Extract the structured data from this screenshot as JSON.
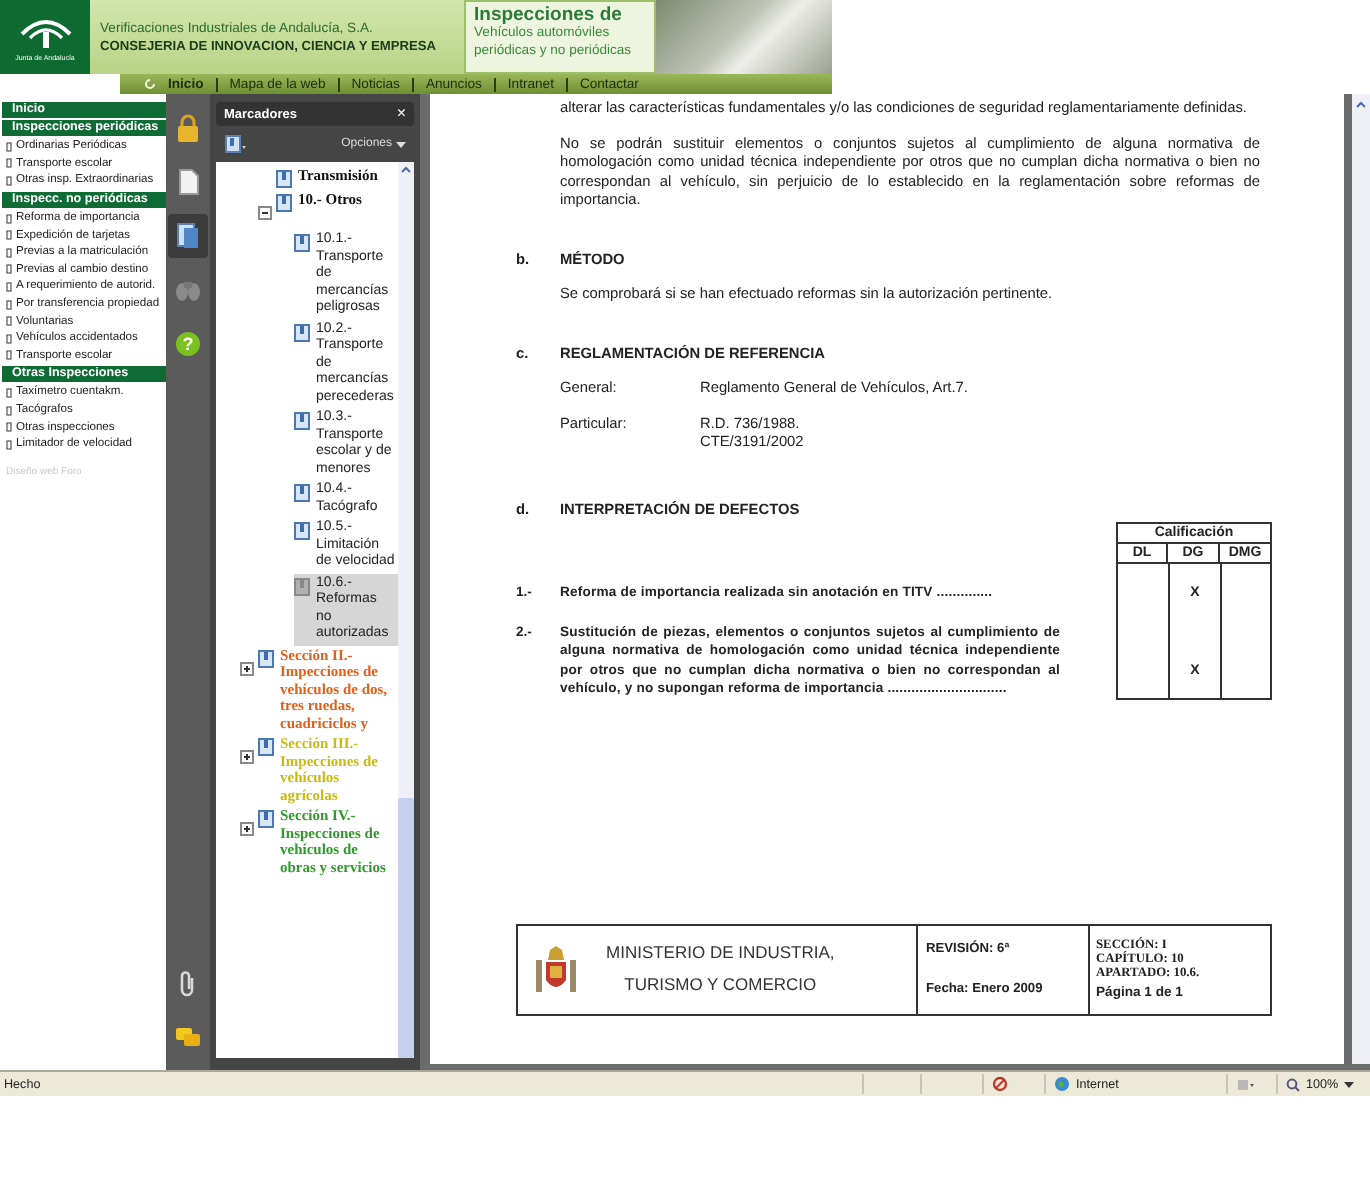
{
  "header": {
    "logo_caption": "Junta de Andalucía",
    "organization": "Verificaciones Industriales de Andalucía, S.A.",
    "department": "CONSEJERIA DE INNOVACION, CIENCIA Y EMPRESA",
    "service_title": "Inspecciones de",
    "service_lines": [
      "Vehículos automóviles",
      "periódicas y no periódicas"
    ]
  },
  "nav": [
    {
      "label": "Inicio",
      "selected": true
    },
    {
      "label": "Mapa de la web",
      "selected": false
    },
    {
      "label": "Noticias",
      "selected": false
    },
    {
      "label": "Anuncios",
      "selected": false
    },
    {
      "label": "Intranet",
      "selected": false
    },
    {
      "label": "Contactar",
      "selected": false
    }
  ],
  "side_menu": {
    "items": [
      {
        "kind": "header",
        "label": "Inicio"
      },
      {
        "kind": "header",
        "label": "Inspecciones periódicas"
      },
      {
        "kind": "item",
        "label": "Ordinarias Periódicas"
      },
      {
        "kind": "item",
        "label": "Transporte escolar"
      },
      {
        "kind": "item",
        "label": "Otras insp. Extraordinarias"
      },
      {
        "kind": "header",
        "label": "Inspecc. no periódicas"
      },
      {
        "kind": "item",
        "label": "Reforma de importancia"
      },
      {
        "kind": "item",
        "label": "Expedición de tarjetas"
      },
      {
        "kind": "item",
        "label": "Previas a la matriculación"
      },
      {
        "kind": "item",
        "label": "Previas al cambio destino"
      },
      {
        "kind": "item",
        "label": "A requerimiento de autorid."
      },
      {
        "kind": "item",
        "label": "Por transferencia propiedad"
      },
      {
        "kind": "item",
        "label": "Voluntarias"
      },
      {
        "kind": "item",
        "label": "Vehículos accidentados"
      },
      {
        "kind": "item",
        "label": "Transporte escolar"
      },
      {
        "kind": "header",
        "label": "Otras Inspecciones"
      },
      {
        "kind": "item",
        "label": "Taxímetro cuentakm."
      },
      {
        "kind": "item",
        "label": "Tacógrafos"
      },
      {
        "kind": "item",
        "label": "Otras inspecciones"
      },
      {
        "kind": "item",
        "label": "Limitador de velocidad"
      }
    ],
    "footer": "Diseño web Foro"
  },
  "viewer": {
    "tools": [
      {
        "kind": "lock",
        "selected": false
      },
      {
        "kind": "pages",
        "selected": false
      },
      {
        "kind": "bookmarks",
        "selected": true
      },
      {
        "kind": "binoculars",
        "selected": false
      },
      {
        "kind": "help",
        "symbol": "?",
        "selected": false
      }
    ],
    "bottom_tools": [
      {
        "kind": "paperclip"
      },
      {
        "kind": "comments"
      }
    ]
  },
  "bookmarks": {
    "title": "Marcadores",
    "close": "×",
    "options": "Opciones",
    "tree": [
      {
        "kind": "hidden",
        "children": [
          {
            "kind": "chapter",
            "label": "Transmisión",
            "selected": false
          },
          {
            "kind": "chapter",
            "label": "10.- Otros",
            "expanded": true,
            "selected": false,
            "children": [
              {
                "kind": "article",
                "label": "10.1.- Transporte de mercancías peligrosas",
                "selected": false
              },
              {
                "kind": "article",
                "label": "10.2.- Transporte de mercancías perecederas",
                "selected": false
              },
              {
                "kind": "article",
                "label": "10.3.- Transporte escolar y de menores",
                "selected": false
              },
              {
                "kind": "article",
                "label": "10.4.- Tacógrafo",
                "selected": false
              },
              {
                "kind": "article",
                "label": "10.5.- Limitación de velocidad",
                "selected": false
              },
              {
                "kind": "article",
                "label": "10.6.- Reformas no autorizadas",
                "selected": true
              }
            ]
          }
        ]
      },
      {
        "kind": "section",
        "label": "Sección II.- Impecciones de vehículos de dos, tres ruedas, cuadriciclos y",
        "expanded": false,
        "selected": false,
        "color": "#e0601c"
      },
      {
        "kind": "section",
        "label": "Sección III.- Impecciones de vehículos agrícolas",
        "expanded": false,
        "selected": false,
        "color": "#c9bb10"
      },
      {
        "kind": "section",
        "label": "Sección IV.- Inspecciones de vehículos de obras y servicios",
        "expanded": false,
        "selected": false,
        "color": "#2f9a2a"
      }
    ]
  },
  "document": {
    "paragraphs": [
      "alterar las características fundamentales y/o las condiciones de seguridad reglamentariamente definidas.",
      "No se podrán sustituir elementos o conjuntos sujetos al cumplimiento de alguna normativa de homologación como unidad técnica independiente por otros que no cumplan dicha normativa o bien no correspondan al vehículo, sin perjuicio de lo establecido en la reglamentación sobre reformas de importancia."
    ],
    "sections": [
      {
        "kind": "text",
        "letter": "b.",
        "title": "MÉTODO",
        "text": "Se comprobará si se han efectuado reformas sin la autorización pertinente."
      },
      {
        "kind": "references",
        "letter": "c.",
        "title": "REGLAMENTACIÓN DE REFERENCIA",
        "references": [
          {
            "label": "General:",
            "lines": [
              "Reglamento General de Vehículos, Art.7."
            ]
          },
          {
            "label": "Particular:",
            "lines": [
              "R.D. 736/1988.",
              "CTE/3191/2002"
            ]
          }
        ]
      },
      {
        "kind": "defects",
        "letter": "d.",
        "title": "INTERPRETACIÓN DE DEFECTOS",
        "grading_title": "Calificación",
        "grades": [
          "DL",
          "DG",
          "DMG"
        ],
        "defects": [
          {
            "number": "1.-",
            "text": "Reforma de importancia realizada sin anotación en TITV ..............",
            "marks": [
              {
                "checked": false
              },
              {
                "checked": true,
                "symbol": "X"
              },
              {
                "checked": false
              }
            ]
          },
          {
            "number": "2.-",
            "text": "Sustitución de piezas, elementos o conjuntos sujetos al cumplimiento de alguna normativa de homologación como unidad técnica independiente por otros que no cumplan dicha normativa o bien no correspondan al vehículo, y no supongan reforma de importancia ..............................",
            "marks": [
              {
                "checked": false
              },
              {
                "checked": true,
                "symbol": "X"
              },
              {
                "checked": false
              }
            ]
          }
        ]
      }
    ],
    "footer": {
      "ministry_lines": [
        "MINISTERIO DE INDUSTRIA,",
        "TURISMO Y COMERCIO"
      ],
      "revision": "REVISIÓN: 6ª",
      "date": "Fecha: Enero 2009",
      "location_lines": [
        "SECCIÓN: I",
        "CAPÍTULO: 10",
        "APARTADO: 10.6."
      ],
      "page": "Página 1 de 1"
    }
  },
  "status_bar": {
    "text": "Hecho",
    "zone": "Internet",
    "zoom": "100%"
  }
}
